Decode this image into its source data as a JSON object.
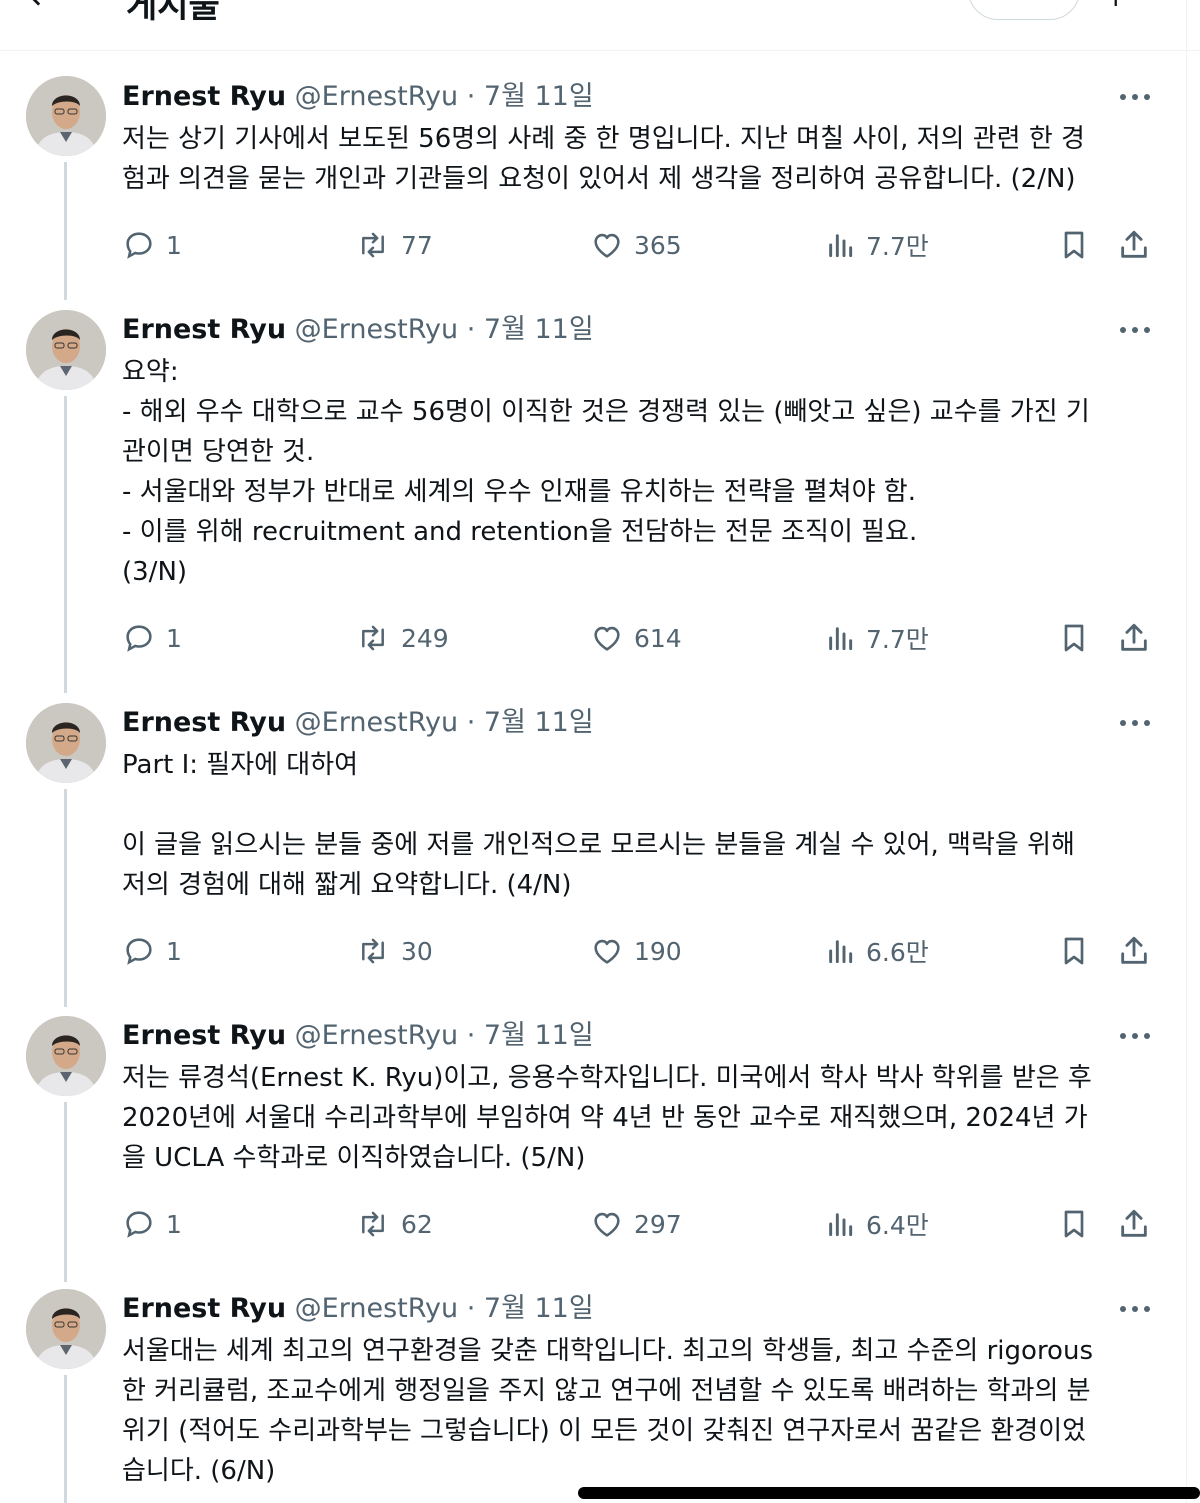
{
  "header": {
    "title": "게시물"
  },
  "tweets": [
    {
      "author": "Ernest Ryu",
      "handle": "@ErnestRyu",
      "separator": "·",
      "date": "7월 11일",
      "lines": [
        "저는 상기 기사에서 보도된 56명의 사례 중 한 명입니다. 지난 며칠 사이, 저의 관련 한 경",
        "험과 의견을 묻는 개인과 기관들의 요청이 있어서 제 생각을 정리하여 공유합니다. (2/N)"
      ],
      "replies": "1",
      "reposts": "77",
      "likes": "365",
      "views": "7.7만"
    },
    {
      "author": "Ernest Ryu",
      "handle": "@ErnestRyu",
      "separator": "·",
      "date": "7월 11일",
      "lines": [
        "요약:",
        "- 해외 우수 대학으로 교수 56명이 이직한 것은 경쟁력 있는 (빼앗고 싶은) 교수를 가진 기",
        "관이면 당연한 것.",
        "- 서울대와 정부가 반대로 세계의 우수 인재를 유치하는 전략을 펼쳐야 함.",
        "- 이를 위해 recruitment and retention을 전담하는 전문 조직이 필요.",
        "(3/N)"
      ],
      "replies": "1",
      "reposts": "249",
      "likes": "614",
      "views": "7.7만"
    },
    {
      "author": "Ernest Ryu",
      "handle": "@ErnestRyu",
      "separator": "·",
      "date": "7월 11일",
      "lines": [
        "Part I: 필자에 대하여",
        "",
        "이 글을 읽으시는 분들 중에 저를 개인적으로 모르시는 분들을 계실 수 있어, 맥락을 위해",
        "저의 경험에 대해 짧게 요약합니다. (4/N)"
      ],
      "replies": "1",
      "reposts": "30",
      "likes": "190",
      "views": "6.6만"
    },
    {
      "author": "Ernest Ryu",
      "handle": "@ErnestRyu",
      "separator": "·",
      "date": "7월 11일",
      "lines": [
        "저는 류경석(Ernest K. Ryu)이고, 응용수학자입니다. 미국에서 학사 박사 학위를 받은 후",
        "2020년에 서울대 수리과학부에 부임하여 약 4년 반 동안 교수로 재직했으며, 2024년 가",
        "을 UCLA 수학과로 이직하였습니다. (5/N)"
      ],
      "replies": "1",
      "reposts": "62",
      "likes": "297",
      "views": "6.4만"
    },
    {
      "author": "Ernest Ryu",
      "handle": "@ErnestRyu",
      "separator": "·",
      "date": "7월 11일",
      "lines": [
        "서울대는 세계 최고의 연구환경을 갖춘 대학입니다. 최고의 학생들, 최고 수준의 rigorous",
        "한 커리큘럼, 조교수에게 행정일을 주지 않고 연구에 전념할 수 있도록 배려하는 학과의 분",
        "위기 (적어도 수리과학부는 그렇습니다) 이 모든 것이 갖춰진 연구자로서 꿈같은 환경이었",
        "습니다. (6/N)"
      ]
    }
  ],
  "icons": {
    "reply": "reply-icon",
    "repost": "repost-icon",
    "like": "heart-icon",
    "views": "views-icon",
    "bookmark": "bookmark-icon",
    "share": "share-icon",
    "more": "more-icon"
  },
  "colors": {
    "text": "#0f1419",
    "secondary": "#536471",
    "thread_line": "#cfd9de",
    "divider": "#eff3f4"
  }
}
